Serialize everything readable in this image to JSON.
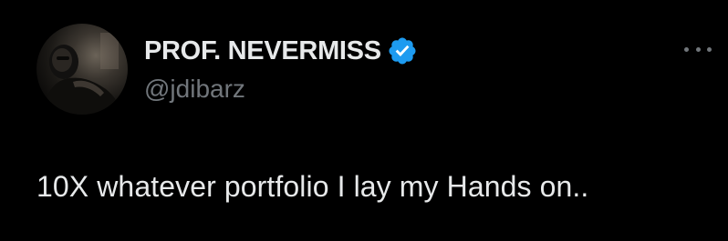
{
  "author": {
    "display_name": "PROF. NEVERMISS",
    "handle": "@jdibarz",
    "verified": true,
    "avatar_icon": "profile-photo"
  },
  "more_icon": "ellipsis-icon",
  "tweet": {
    "text": "10X whatever portfolio I lay my Hands on.."
  },
  "colors": {
    "background": "#000000",
    "text_primary": "#e7e9ea",
    "text_secondary": "#71767b",
    "verified_blue": "#1d9bf0"
  }
}
